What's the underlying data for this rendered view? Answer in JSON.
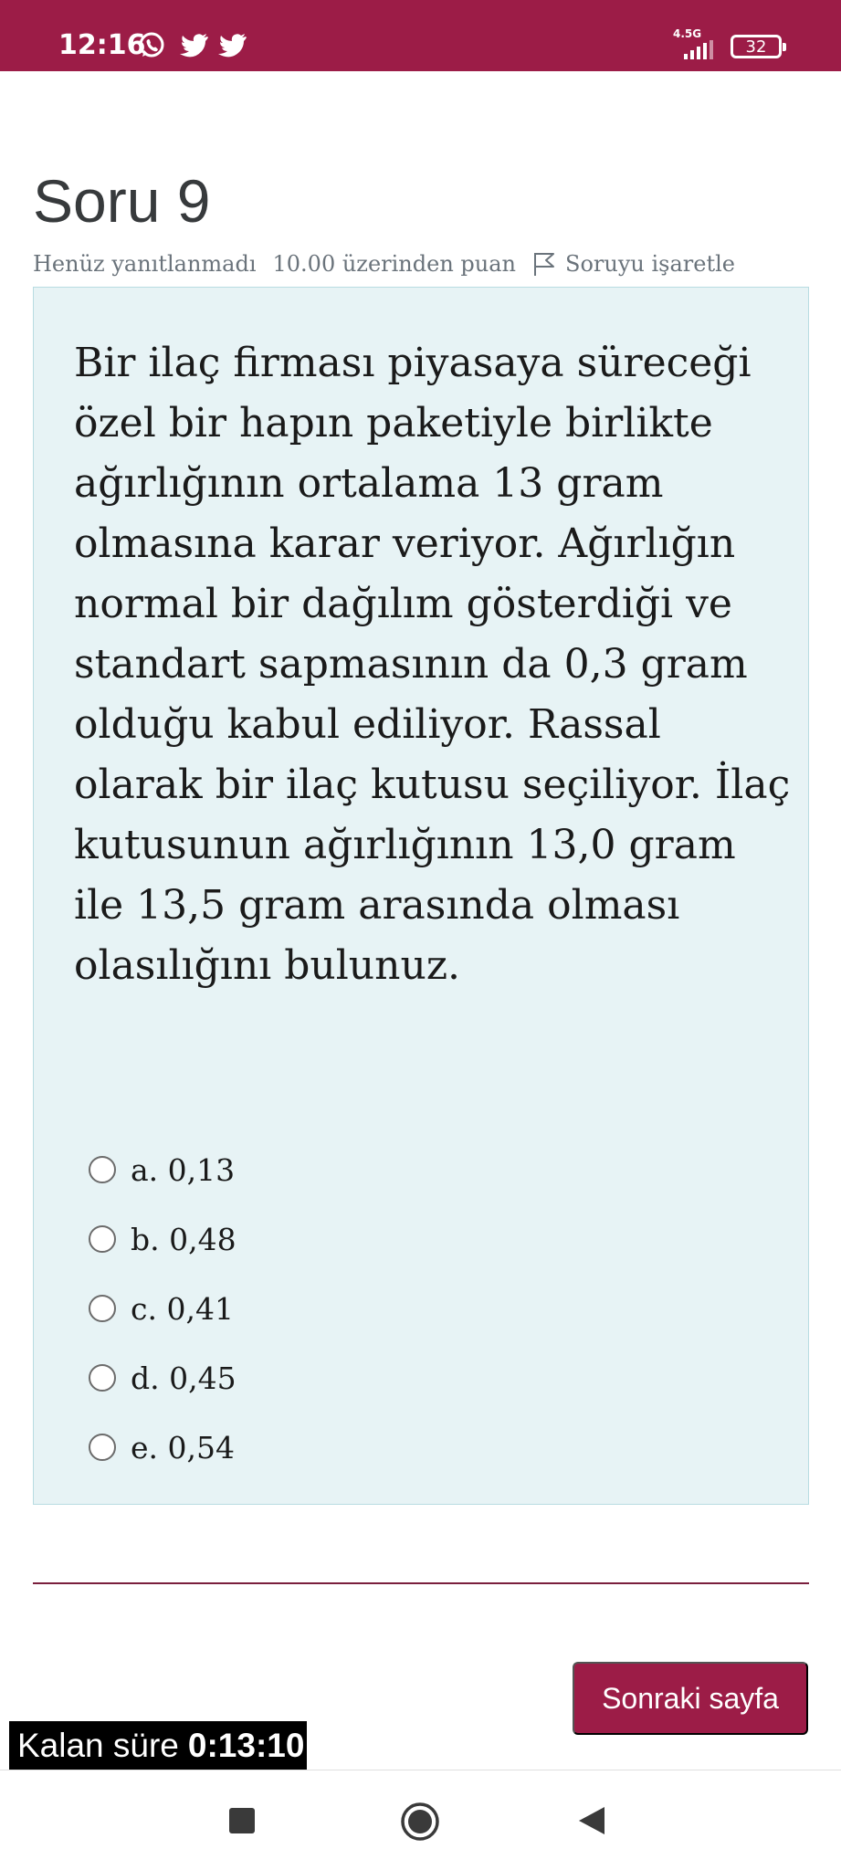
{
  "status_bar": {
    "time": "12:16",
    "network": "4.5G",
    "battery": "32",
    "notification_icons": [
      "whatsapp-icon",
      "twitter-icon",
      "twitter-icon"
    ],
    "bg_color": "#9c1c47"
  },
  "question": {
    "title": "Soru 9",
    "state": "Henüz yanıtlanmadı",
    "grade": "10.00 üzerinden puan",
    "flag_label": "Soruyu işaretle",
    "text": "Bir ilaç firması piyasaya süreceği özel bir hapın paketiyle birlikte ağırlığının ortalama 13 gram olmasına karar veriyor. Ağırlığın normal bir dağılım gösterdiği ve standart sapmasının da 0,3 gram olduğu kabul ediliyor. Rassal olarak bir ilaç kutusu seçiliyor. İlaç kutusunun ağırlığının 13,0 gram ile 13,5 gram arasında olması olasılığını bulunuz.",
    "answers": [
      {
        "label": "a. 0,13"
      },
      {
        "label": "b. 0,48"
      },
      {
        "label": "c. 0,41"
      },
      {
        "label": "d. 0,45"
      },
      {
        "label": "e. 0,54"
      }
    ]
  },
  "navigation": {
    "next_label": "Sonraki sayfa",
    "accent_color": "#9c1c47"
  },
  "timer": {
    "label": "Kalan süre",
    "value": "0:13:10"
  },
  "system_nav": [
    "recents-icon",
    "home-icon",
    "back-icon"
  ]
}
